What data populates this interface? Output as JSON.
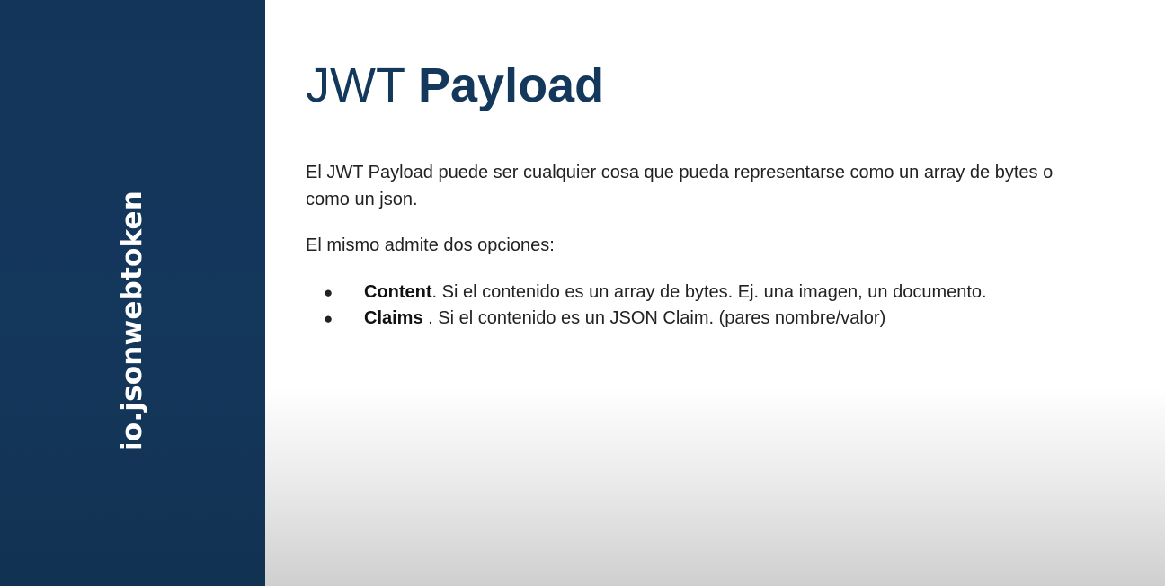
{
  "sidebar": {
    "label": "io.jsonwebtoken"
  },
  "slide": {
    "title_regular": "JWT ",
    "title_bold": "Payload",
    "paragraph_1": "El JWT Payload puede ser cualquier cosa que pueda representarse como un array de bytes o como un json.",
    "paragraph_2": "El mismo admite dos opciones:",
    "bullet_glyph": "●",
    "bullets": [
      {
        "term": "Content",
        "text": ". Si el contenido es un array de bytes. Ej. una imagen, un documento."
      },
      {
        "term": "Claims",
        "text": " . Si el contenido es un JSON Claim. (pares nombre/valor)"
      }
    ]
  },
  "colors": {
    "sidebar_background": "#13355a",
    "title_color": "#14385c",
    "body_text": "#222222"
  }
}
